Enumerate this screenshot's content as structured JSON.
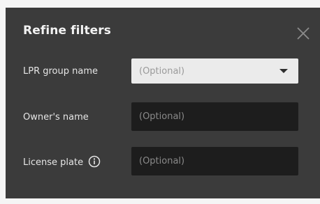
{
  "dialog": {
    "title": "Refine filters",
    "close_icon": "close-icon"
  },
  "fields": [
    {
      "label": "LPR group name",
      "placeholder": "(Optional)",
      "value": "",
      "type": "select"
    },
    {
      "label": "Owner's name",
      "placeholder": "(Optional)",
      "value": "",
      "type": "text"
    },
    {
      "label": "License plate",
      "placeholder": "(Optional)",
      "value": "",
      "type": "text",
      "info_icon": "info-icon"
    }
  ],
  "colors": {
    "dialog_background": "#3b3b3b",
    "input_background": "#1d1d1d",
    "select_background": "#ebebeb",
    "text": "#e6e6e6"
  }
}
